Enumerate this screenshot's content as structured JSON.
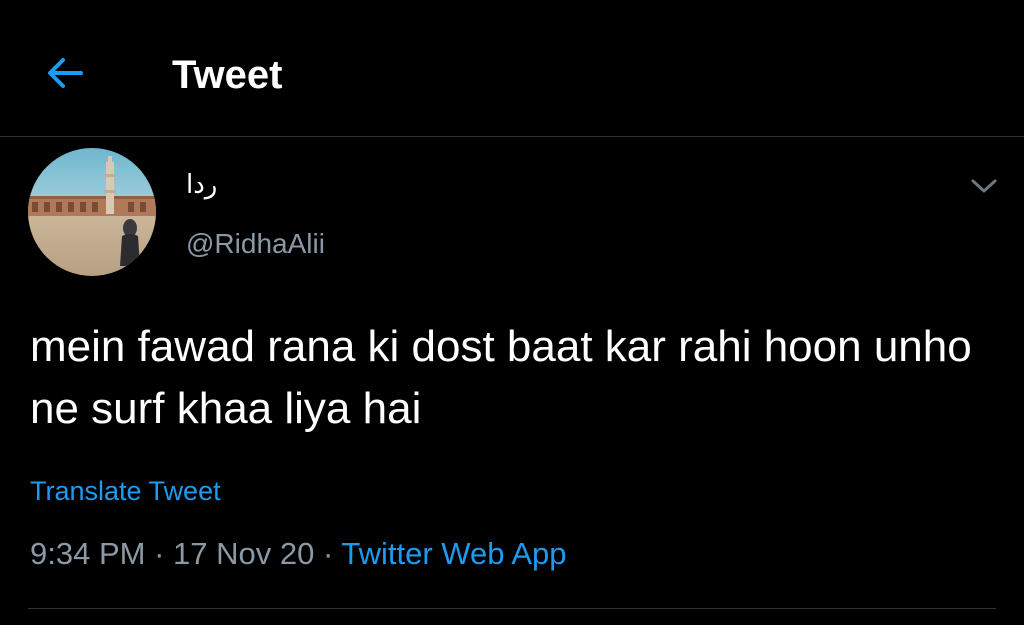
{
  "header": {
    "back_icon": "arrow-left-icon",
    "title": "Tweet"
  },
  "author": {
    "display_name": "ردا",
    "handle": "@RidhaAlii",
    "avatar_icon": "profile-photo"
  },
  "more_icon": "chevron-down-icon",
  "tweet": {
    "text": "mein fawad rana ki dost baat kar rahi hoon unho ne surf khaa liya hai",
    "translate_label": "Translate Tweet"
  },
  "meta": {
    "time": "9:34 PM",
    "separator": "·",
    "date": "17 Nov 20",
    "source": "Twitter Web App"
  },
  "colors": {
    "background": "#000000",
    "accent": "#1d9bf0",
    "secondary_text": "#8b98a5",
    "divider": "#2f3336"
  }
}
